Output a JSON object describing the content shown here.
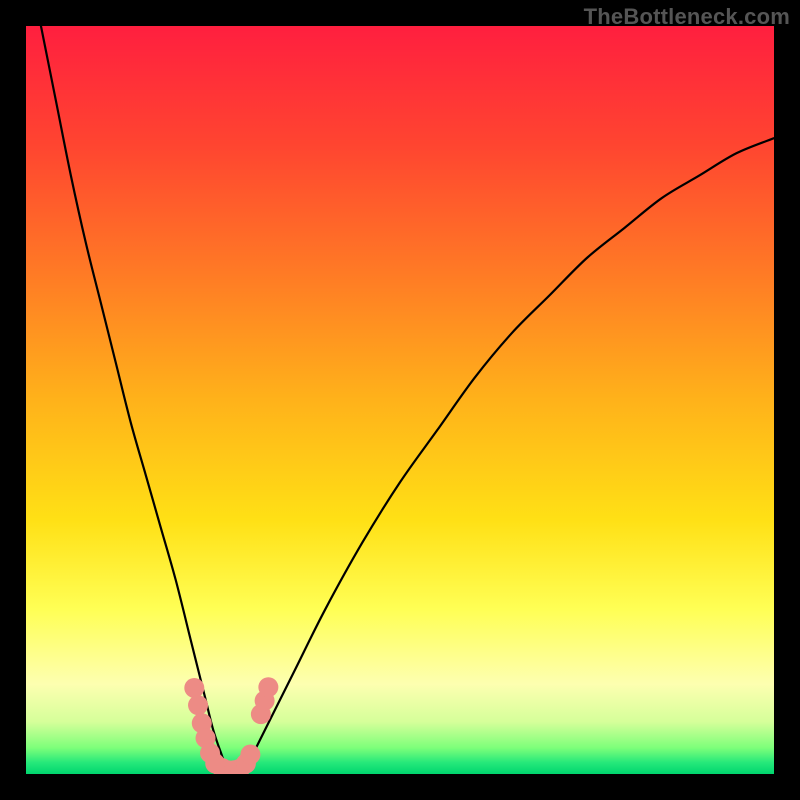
{
  "watermark": "TheBottleneck.com",
  "chart_data": {
    "type": "line",
    "title": "",
    "xlabel": "",
    "ylabel": "",
    "xlim": [
      0,
      100
    ],
    "ylim": [
      0,
      100
    ],
    "grid": false,
    "legend": false,
    "annotations": [],
    "background_gradient_stops": [
      {
        "offset": 0.0,
        "color": "#ff1f3f"
      },
      {
        "offset": 0.16,
        "color": "#ff4530"
      },
      {
        "offset": 0.33,
        "color": "#ff7a25"
      },
      {
        "offset": 0.5,
        "color": "#ffb21a"
      },
      {
        "offset": 0.66,
        "color": "#ffe015"
      },
      {
        "offset": 0.78,
        "color": "#ffff55"
      },
      {
        "offset": 0.88,
        "color": "#fdffb0"
      },
      {
        "offset": 0.93,
        "color": "#d6ff9a"
      },
      {
        "offset": 0.965,
        "color": "#7dff7a"
      },
      {
        "offset": 0.985,
        "color": "#25e87a"
      },
      {
        "offset": 1.0,
        "color": "#00d66f"
      }
    ],
    "series": [
      {
        "name": "bottleneck-curve",
        "note": "V-shaped curve; y is distance above plot bottom in percent of plot height. Minimum (y≈0) near x≈27.",
        "x": [
          2,
          4,
          6,
          8,
          10,
          12,
          14,
          16,
          18,
          20,
          22,
          23,
          24,
          25,
          26,
          27,
          28,
          29,
          30,
          31,
          33,
          36,
          40,
          45,
          50,
          55,
          60,
          65,
          70,
          75,
          80,
          85,
          90,
          95,
          100
        ],
        "y": [
          100,
          90,
          80,
          71,
          63,
          55,
          47,
          40,
          33,
          26,
          18,
          14,
          10,
          6,
          3,
          0.5,
          0.2,
          0.5,
          2,
          4,
          8,
          14,
          22,
          31,
          39,
          46,
          53,
          59,
          64,
          69,
          73,
          77,
          80,
          83,
          85
        ]
      }
    ],
    "markers": [
      {
        "name": "highlight-cluster",
        "color": "#ed8b85",
        "note": "Salmon dots near curve bottom; y in percent of plot height from bottom.",
        "points": [
          {
            "x": 22.5,
            "y": 11.5
          },
          {
            "x": 23.0,
            "y": 9.2
          },
          {
            "x": 23.5,
            "y": 6.8
          },
          {
            "x": 24.0,
            "y": 4.8
          },
          {
            "x": 24.6,
            "y": 2.8
          },
          {
            "x": 25.3,
            "y": 1.4
          },
          {
            "x": 26.2,
            "y": 0.8
          },
          {
            "x": 27.0,
            "y": 0.5
          },
          {
            "x": 27.8,
            "y": 0.5
          },
          {
            "x": 28.6,
            "y": 0.7
          },
          {
            "x": 29.4,
            "y": 1.4
          },
          {
            "x": 30.0,
            "y": 2.6
          },
          {
            "x": 31.4,
            "y": 8.0
          },
          {
            "x": 31.9,
            "y": 9.8
          },
          {
            "x": 32.4,
            "y": 11.6
          }
        ]
      }
    ]
  }
}
